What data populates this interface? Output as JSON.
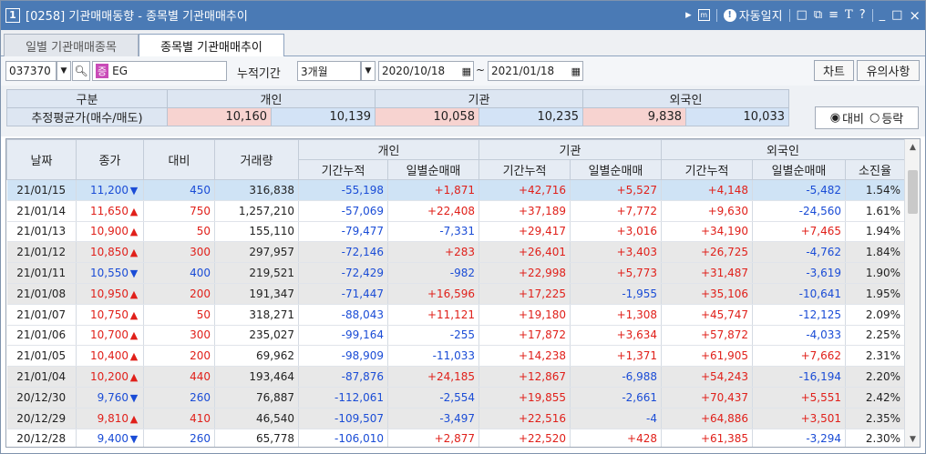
{
  "window": {
    "num": "1",
    "title": "[0258] 기관매매동향 - 종목별 기관매매추이",
    "icons": [
      "play-icon",
      "screen-icon",
      "info-icon"
    ],
    "autolog_label": "자동일지",
    "right_glyphs": [
      "□",
      "⧉",
      "≡",
      "T",
      "?"
    ],
    "minimize": "_",
    "maximize": "□",
    "close": "×"
  },
  "tabs": [
    {
      "label": "일별 기관매매종목"
    },
    {
      "label": "종목별 기관매매추이"
    }
  ],
  "controls": {
    "code": "037370",
    "market_badge": "증",
    "name": "EG",
    "period_label": "누적기간",
    "period_value": "3개월",
    "date_from": "2020/10/18",
    "date_to": "2021/01/18",
    "tilde": "~",
    "chart_btn": "차트",
    "notice_btn": "유의사항"
  },
  "summary": {
    "col_label": "구분",
    "row_label": "추정평균가(매수/매도)",
    "groups": [
      "개인",
      "기관",
      "외국인"
    ],
    "values": [
      "10,160",
      "10,139",
      "10,058",
      "10,235",
      "9,838",
      "10,033"
    ]
  },
  "radio": {
    "option1": "대비",
    "option2": "등락",
    "selected": "대비"
  },
  "grid": {
    "headers_top": [
      "날짜",
      "종가",
      "대비",
      "거래량",
      "개인",
      "기관",
      "외국인"
    ],
    "headers_sub": [
      "기간누적",
      "일별순매매",
      "기간누적",
      "일별순매매",
      "기간누적",
      "일별순매매",
      "소진율"
    ],
    "rows": [
      {
        "date": "21/01/15",
        "close": "11,200",
        "dir": "down",
        "diff": "450",
        "volume": "316,838",
        "ind_cum": "-55,198",
        "ind_day": "+1,871",
        "inst_cum": "+42,716",
        "inst_day": "+5,527",
        "for_cum": "+4,148",
        "for_day": "-5,482",
        "rate": "1.54%"
      },
      {
        "date": "21/01/14",
        "close": "11,650",
        "dir": "up",
        "diff": "750",
        "volume": "1,257,210",
        "ind_cum": "-57,069",
        "ind_day": "+22,408",
        "inst_cum": "+37,189",
        "inst_day": "+7,772",
        "for_cum": "+9,630",
        "for_day": "-24,560",
        "rate": "1.61%"
      },
      {
        "date": "21/01/13",
        "close": "10,900",
        "dir": "up",
        "diff": "50",
        "volume": "155,110",
        "ind_cum": "-79,477",
        "ind_day": "-7,331",
        "inst_cum": "+29,417",
        "inst_day": "+3,016",
        "for_cum": "+34,190",
        "for_day": "+7,465",
        "rate": "1.94%"
      },
      {
        "date": "21/01/12",
        "close": "10,850",
        "dir": "up",
        "diff": "300",
        "volume": "297,957",
        "ind_cum": "-72,146",
        "ind_day": "+283",
        "inst_cum": "+26,401",
        "inst_day": "+3,403",
        "for_cum": "+26,725",
        "for_day": "-4,762",
        "rate": "1.84%"
      },
      {
        "date": "21/01/11",
        "close": "10,550",
        "dir": "down",
        "diff": "400",
        "volume": "219,521",
        "ind_cum": "-72,429",
        "ind_day": "-982",
        "inst_cum": "+22,998",
        "inst_day": "+5,773",
        "for_cum": "+31,487",
        "for_day": "-3,619",
        "rate": "1.90%"
      },
      {
        "date": "21/01/08",
        "close": "10,950",
        "dir": "up",
        "diff": "200",
        "volume": "191,347",
        "ind_cum": "-71,447",
        "ind_day": "+16,596",
        "inst_cum": "+17,225",
        "inst_day": "-1,955",
        "for_cum": "+35,106",
        "for_day": "-10,641",
        "rate": "1.95%"
      },
      {
        "date": "21/01/07",
        "close": "10,750",
        "dir": "up",
        "diff": "50",
        "volume": "318,271",
        "ind_cum": "-88,043",
        "ind_day": "+11,121",
        "inst_cum": "+19,180",
        "inst_day": "+1,308",
        "for_cum": "+45,747",
        "for_day": "-12,125",
        "rate": "2.09%"
      },
      {
        "date": "21/01/06",
        "close": "10,700",
        "dir": "up",
        "diff": "300",
        "volume": "235,027",
        "ind_cum": "-99,164",
        "ind_day": "-255",
        "inst_cum": "+17,872",
        "inst_day": "+3,634",
        "for_cum": "+57,872",
        "for_day": "-4,033",
        "rate": "2.25%"
      },
      {
        "date": "21/01/05",
        "close": "10,400",
        "dir": "up",
        "diff": "200",
        "volume": "69,962",
        "ind_cum": "-98,909",
        "ind_day": "-11,033",
        "inst_cum": "+14,238",
        "inst_day": "+1,371",
        "for_cum": "+61,905",
        "for_day": "+7,662",
        "rate": "2.31%"
      },
      {
        "date": "21/01/04",
        "close": "10,200",
        "dir": "up",
        "diff": "440",
        "volume": "193,464",
        "ind_cum": "-87,876",
        "ind_day": "+24,185",
        "inst_cum": "+12,867",
        "inst_day": "-6,988",
        "for_cum": "+54,243",
        "for_day": "-16,194",
        "rate": "2.20%"
      },
      {
        "date": "20/12/30",
        "close": "9,760",
        "dir": "down",
        "diff": "260",
        "volume": "76,887",
        "ind_cum": "-112,061",
        "ind_day": "-2,554",
        "inst_cum": "+19,855",
        "inst_day": "-2,661",
        "for_cum": "+70,437",
        "for_day": "+5,551",
        "rate": "2.42%"
      },
      {
        "date": "20/12/29",
        "close": "9,810",
        "dir": "up",
        "diff": "410",
        "volume": "46,540",
        "ind_cum": "-109,507",
        "ind_day": "-3,497",
        "inst_cum": "+22,516",
        "inst_day": "-4",
        "for_cum": "+64,886",
        "for_day": "+3,501",
        "rate": "2.35%"
      },
      {
        "date": "20/12/28",
        "close": "9,400",
        "dir": "down",
        "diff": "260",
        "volume": "65,778",
        "ind_cum": "-106,010",
        "ind_day": "+2,877",
        "inst_cum": "+22,520",
        "inst_day": "+428",
        "for_cum": "+61,385",
        "for_day": "-3,294",
        "rate": "2.30%"
      }
    ]
  },
  "colors": {
    "up": "#e0201a",
    "down": "#1a4cd6",
    "title_bar": "#4a7ab5",
    "selected_row": "#cfe3f5",
    "gray_row": "#e8e8e8"
  }
}
